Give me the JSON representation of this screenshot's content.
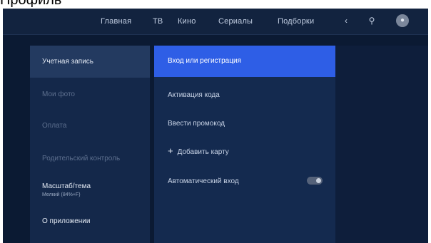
{
  "page": {
    "heading": "Профиль"
  },
  "nav": {
    "items": [
      "Главная",
      "ТВ",
      "Кино",
      "Сериалы",
      "Подборки"
    ],
    "icons": [
      "share-icon",
      "search-icon",
      "avatar-icon"
    ]
  },
  "sidebar": {
    "items": [
      {
        "label": "Учетная запись",
        "state": "active"
      },
      {
        "label": "Мои фото",
        "state": "dim"
      },
      {
        "label": "Оплата",
        "state": "dim"
      },
      {
        "label": "Родительский контроль",
        "state": "dim"
      },
      {
        "label": "Масштаб/тема",
        "sub": "Мелкий (84%+F)",
        "state": "bright"
      },
      {
        "label": "О приложении",
        "state": "bright"
      }
    ]
  },
  "account_menu": {
    "items": [
      {
        "label": "Вход или регистрация",
        "state": "active"
      },
      {
        "label": "Активация кода"
      },
      {
        "label": "Ввести промокод"
      },
      {
        "label": "Добавить карту",
        "icon": "plus-icon"
      },
      {
        "label": "Автоматический вход",
        "toggle": true
      }
    ]
  }
}
